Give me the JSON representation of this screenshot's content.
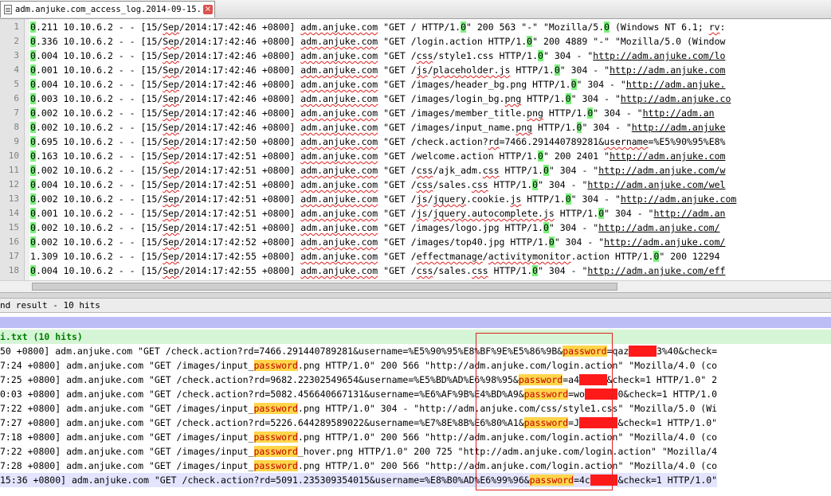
{
  "tab": {
    "title": "adm.anjuke.com_access_log.2014-09-15.txt",
    "close_glyph": "×"
  },
  "editor": {
    "lines": [
      {
        "num": "1",
        "html": "<span class=\"m\">0</span>.211 10.10.6.2 - - [15/<span class=\"u\">Sep</span>/2014:17:42:46 +0800] <span class=\"u\">adm.anjuke.com</span> \"GET / HTTP/1.<span class=\"m\">0</span>\" 200 563 \"-\" \"Mozilla/5.<span class=\"m\">0</span> (Windows NT 6.1; <span class=\"u\">rv</span>:"
      },
      {
        "num": "2",
        "html": "<span class=\"m\">0</span>.336 10.10.6.2 - - [15/<span class=\"u\">Sep</span>/2014:17:42:46 +0800] <span class=\"u\">adm.anjuke.com</span> \"GET /login.action HTTP/1.<span class=\"m\">0</span>\" 200 4889 \"-\" \"Mozilla/5.0 (Window"
      },
      {
        "num": "3",
        "html": "<span class=\"m\">0</span>.004 10.10.6.2 - - [15/<span class=\"u\">Sep</span>/2014:17:42:46 +0800] <span class=\"u\">adm.anjuke.com</span> \"GET /<span class=\"u\">css</span>/style1.css HTTP/1.<span class=\"m\">0</span>\" 304 - \"<span class=\"url\">http://adm.anjuke.com/lo</span>"
      },
      {
        "num": "4",
        "html": "<span class=\"m\">0</span>.001 10.10.6.2 - - [15/<span class=\"u\">Sep</span>/2014:17:42:46 +0800] <span class=\"u\">adm.anjuke.com</span> \"GET /<span class=\"u\">js</span>/<span class=\"u\">placeholder.js</span> HTTP/1.<span class=\"m\">0</span>\" 304 - \"<span class=\"url\">http://adm.anjuke.com</span>"
      },
      {
        "num": "5",
        "html": "<span class=\"m\">0</span>.004 10.10.6.2 - - [15/<span class=\"u\">Sep</span>/2014:17:42:46 +0800] <span class=\"u\">adm.anjuke.com</span> \"GET /images/header_bg.png HTTP/1.<span class=\"m\">0</span>\" 304 - \"<span class=\"url\">http://adm.anjuke.</span>"
      },
      {
        "num": "6",
        "html": "<span class=\"m\">0</span>.003 10.10.6.2 - - [15/<span class=\"u\">Sep</span>/2014:17:42:46 +0800] <span class=\"u\">adm.anjuke.com</span> \"GET /images/login_bg.<span class=\"u\">png</span> HTTP/1.<span class=\"m\">0</span>\" 304 - \"<span class=\"url\">http://adm.anjuke.co</span>"
      },
      {
        "num": "7",
        "html": "<span class=\"m\">0</span>.002 10.10.6.2 - - [15/<span class=\"u\">Sep</span>/2014:17:42:46 +0800] <span class=\"u\">adm.anjuke.com</span> \"GET /images/member_title.<span class=\"u\">png</span> HTTP/1.<span class=\"m\">0</span>\" 304 - \"<span class=\"url\">http://adm.an</span>"
      },
      {
        "num": "8",
        "html": "<span class=\"m\">0</span>.002 10.10.6.2 - - [15/<span class=\"u\">Sep</span>/2014:17:42:46 +0800] <span class=\"u\">adm.anjuke.com</span> \"GET /images/input_name.<span class=\"u\">png</span> HTTP/1.<span class=\"m\">0</span>\" 304 - \"<span class=\"url\">http://adm.anjuke</span>"
      },
      {
        "num": "9",
        "html": "<span class=\"m\">0</span>.695 10.10.6.2 - - [15/<span class=\"u\">Sep</span>/2014:17:42:50 +0800] <span class=\"u\">adm.anjuke.com</span> \"GET /check.action?<span class=\"u\">rd</span>=7466.291440789281&amp;<span class=\"u\">username</span>=%E5%90%95%E8%"
      },
      {
        "num": "10",
        "html": "<span class=\"m\">0</span>.163 10.10.6.2 - - [15/<span class=\"u\">Sep</span>/2014:17:42:51 +0800] <span class=\"u\">adm.anjuke.com</span> \"GET /welcome.action HTTP/1.<span class=\"m\">0</span>\" 200 2401 \"<span class=\"url\">http://adm.anjuke.com</span>"
      },
      {
        "num": "11",
        "html": "<span class=\"m\">0</span>.002 10.10.6.2 - - [15/<span class=\"u\">Sep</span>/2014:17:42:51 +0800] <span class=\"u\">adm.anjuke.com</span> \"GET /<span class=\"u\">css</span>/ajk_adm.<span class=\"u\">css</span> HTTP/1.<span class=\"m\">0</span>\" 304 - \"<span class=\"url\">http://adm.anjuke.com/w</span>"
      },
      {
        "num": "12",
        "html": "<span class=\"m\">0</span>.004 10.10.6.2 - - [15/<span class=\"u\">Sep</span>/2014:17:42:51 +0800] <span class=\"u\">adm.anjuke.com</span> \"GET /<span class=\"u\">css</span>/sales.<span class=\"u\">css</span> HTTP/1.<span class=\"m\">0</span>\" 304 - \"<span class=\"url\">http://adm.anjuke.com/wel</span>"
      },
      {
        "num": "13",
        "html": "<span class=\"m\">0</span>.002 10.10.6.2 - - [15/<span class=\"u\">Sep</span>/2014:17:42:51 +0800] <span class=\"u\">adm.anjuke.com</span> \"GET /<span class=\"u\">js</span>/<span class=\"u\">jquery</span>.cookie.<span class=\"u\">js</span> HTTP/1.<span class=\"m\">0</span>\" 304 - \"<span class=\"url\">http://adm.anjuke.com</span>"
      },
      {
        "num": "14",
        "html": "<span class=\"m\">0</span>.001 10.10.6.2 - - [15/<span class=\"u\">Sep</span>/2014:17:42:51 +0800] <span class=\"u\">adm.anjuke.com</span> \"GET /<span class=\"u\">js</span>/<span class=\"u\">jquery.autocomplete.js</span> HTTP/1.<span class=\"m\">0</span>\" 304 - \"<span class=\"url\">http://adm.an</span>"
      },
      {
        "num": "15",
        "html": "<span class=\"m\">0</span>.002 10.10.6.2 - - [15/<span class=\"u\">Sep</span>/2014:17:42:51 +0800] <span class=\"u\">adm.anjuke.com</span> \"GET /images/logo.jpg HTTP/1.<span class=\"m\">0</span>\" 304 - \"<span class=\"url\">http://adm.anjuke.com/</span>"
      },
      {
        "num": "16",
        "html": "<span class=\"m\">0</span>.002 10.10.6.2 - - [15/<span class=\"u\">Sep</span>/2014:17:42:52 +0800] <span class=\"u\">adm.anjuke.com</span> \"GET /images/top40.jpg HTTP/1.<span class=\"m\">0</span>\" 304 - \"<span class=\"url\">http://adm.anjuke.com/</span>"
      },
      {
        "num": "17",
        "html": "1.309 10.10.6.2 - - [15/<span class=\"u\">Sep</span>/2014:17:42:55 +0800] <span class=\"u\">adm.anjuke.com</span> \"GET /<span class=\"u\">effectmanage</span>/<span class=\"u\">activitymonitor</span>.action HTTP/1.<span class=\"m\">0</span>\" 200 12294"
      },
      {
        "num": "18",
        "html": "<span class=\"m\">0</span>.004 10.10.6.2 - - [15/<span class=\"u\">Sep</span>/2014:17:42:55 +0800] <span class=\"u\">adm.anjuke.com</span> \"GET /<span class=\"u\">css</span>/sales.<span class=\"u\">css</span> HTTP/1.<span class=\"m\">0</span>\" 304 - \"<span class=\"url\">http://adm.anjuke.com/eff</span>"
      }
    ]
  },
  "find_result": {
    "title": "nd result - 10 hits",
    "file_label": "i.txt (10 hits)",
    "lines": [
      {
        "html": "50 +0800] adm.anjuke.com \"GET /check.action?rd=7466.291440789281&amp;username=%E5%90%95%E8%BF%9E%E5%86%9B&amp;<span class=\"kw\">password</span>=qaz<span class=\"redact\">XXXXX</span>3%40&amp;check="
      },
      {
        "html": "7:24 +0800] adm.anjuke.com \"GET /images/input_<span class=\"kw\">password</span>.png HTTP/1.0\" 200 566 \"http://adm.anjuke.com/login.action\" \"Mozilla/4.0 (co"
      },
      {
        "html": "7:25 +0800] adm.anjuke.com \"GET /check.action?rd=9682.22302549654&amp;username=%E5%BD%AD%E6%98%95&amp;<span class=\"kw\">password</span>=a4<span class=\"redact\">XXXXX</span>&amp;check=1 HTTP/1.0\" 2"
      },
      {
        "html": "0:03 +0800] adm.anjuke.com \"GET /check.action?rd=5082.456640667131&amp;username=%E6%AF%9B%E4%BD%A9&amp;<span class=\"kw\">password</span>=wo<span class=\"redact\">XXXXXX</span>0&amp;check=1 HTTP/1.0"
      },
      {
        "html": "7:22 +0800] adm.anjuke.com \"GET /images/input_<span class=\"kw\">password</span>.png HTTP/1.0\" 304 - \"http://adm.anjuke.com/css/style1.css\" \"Mozilla/5.0 (Wi"
      },
      {
        "html": "7:27 +0800] adm.anjuke.com \"GET /check.action?rd=5226.644289589022&amp;username=%E7%8E%8B%E6%80%A1&amp;<span class=\"kw\">password</span>=J<span class=\"redact\">XXXXXXX</span>&amp;check=1 HTTP/1.0\""
      },
      {
        "html": "7:18 +0800] adm.anjuke.com \"GET /images/input_<span class=\"kw\">password</span>.png HTTP/1.0\" 200 566 \"http://adm.anjuke.com/login.action\" \"Mozilla/4.0 (co"
      },
      {
        "html": "7:22 +0800] adm.anjuke.com \"GET /images/input_<span class=\"kw\">password</span>_hover.png HTTP/1.0\" 200 725 \"http://adm.anjuke.com/login.action\" \"Mozilla/4"
      },
      {
        "html": "7:28 +0800] adm.anjuke.com \"GET /images/input_<span class=\"kw\">password</span>.png HTTP/1.0\" 200 566 \"http://adm.anjuke.com/login.action\" \"Mozilla/4.0 (co"
      },
      {
        "html": "15:36 +0800] adm.anjuke.com \"GET /check.action?rd=5091.235309354015&amp;username=%E8%B0%AD%E6%99%96&amp;<span class=\"kw\">password</span>=4c<span class=\"redact\">XXXXX</span>&amp;check=1 HTTP/1.0\""
      }
    ]
  }
}
